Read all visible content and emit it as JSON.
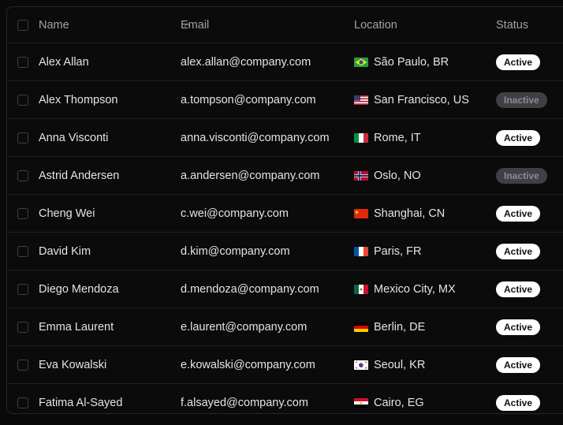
{
  "table": {
    "headers": {
      "name": "Name",
      "email": "Email",
      "location": "Location",
      "status": "Status"
    },
    "sort": {
      "column": "name",
      "direction": "ascending"
    },
    "rows": [
      {
        "name": "Alex Allan",
        "email": "alex.allan@company.com",
        "location": "São Paulo, BR",
        "flag": "brazil-flag-icon",
        "status": "Active"
      },
      {
        "name": "Alex Thompson",
        "email": "a.tompson@company.com",
        "location": "San Francisco, US",
        "flag": "usa-flag-icon",
        "status": "Inactive"
      },
      {
        "name": "Anna Visconti",
        "email": "anna.visconti@company.com",
        "location": "Rome, IT",
        "flag": "italy-flag-icon",
        "status": "Active"
      },
      {
        "name": "Astrid Andersen",
        "email": "a.andersen@company.com",
        "location": "Oslo, NO",
        "flag": "norway-flag-icon",
        "status": "Inactive"
      },
      {
        "name": "Cheng Wei",
        "email": "c.wei@company.com",
        "location": "Shanghai, CN",
        "flag": "china-flag-icon",
        "status": "Active"
      },
      {
        "name": "David Kim",
        "email": "d.kim@company.com",
        "location": "Paris, FR",
        "flag": "france-flag-icon",
        "status": "Active"
      },
      {
        "name": "Diego Mendoza",
        "email": "d.mendoza@company.com",
        "location": "Mexico City, MX",
        "flag": "mexico-flag-icon",
        "status": "Active"
      },
      {
        "name": "Emma Laurent",
        "email": "e.laurent@company.com",
        "location": "Berlin, DE",
        "flag": "germany-flag-icon",
        "status": "Active"
      },
      {
        "name": "Eva Kowalski",
        "email": "e.kowalski@company.com",
        "location": "Seoul, KR",
        "flag": "south-korea-flag-icon",
        "status": "Active"
      },
      {
        "name": "Fatima Al-Sayed",
        "email": "f.alsayed@company.com",
        "location": "Cairo, EG",
        "flag": "egypt-flag-icon",
        "status": "Active"
      }
    ]
  },
  "colors": {
    "background": "#0a0a0b",
    "border": "#26262a",
    "text": "#e4e4e7",
    "muted_text": "#a1a1aa",
    "active_badge": "#ffffff",
    "inactive_badge": "#3f3f46"
  }
}
